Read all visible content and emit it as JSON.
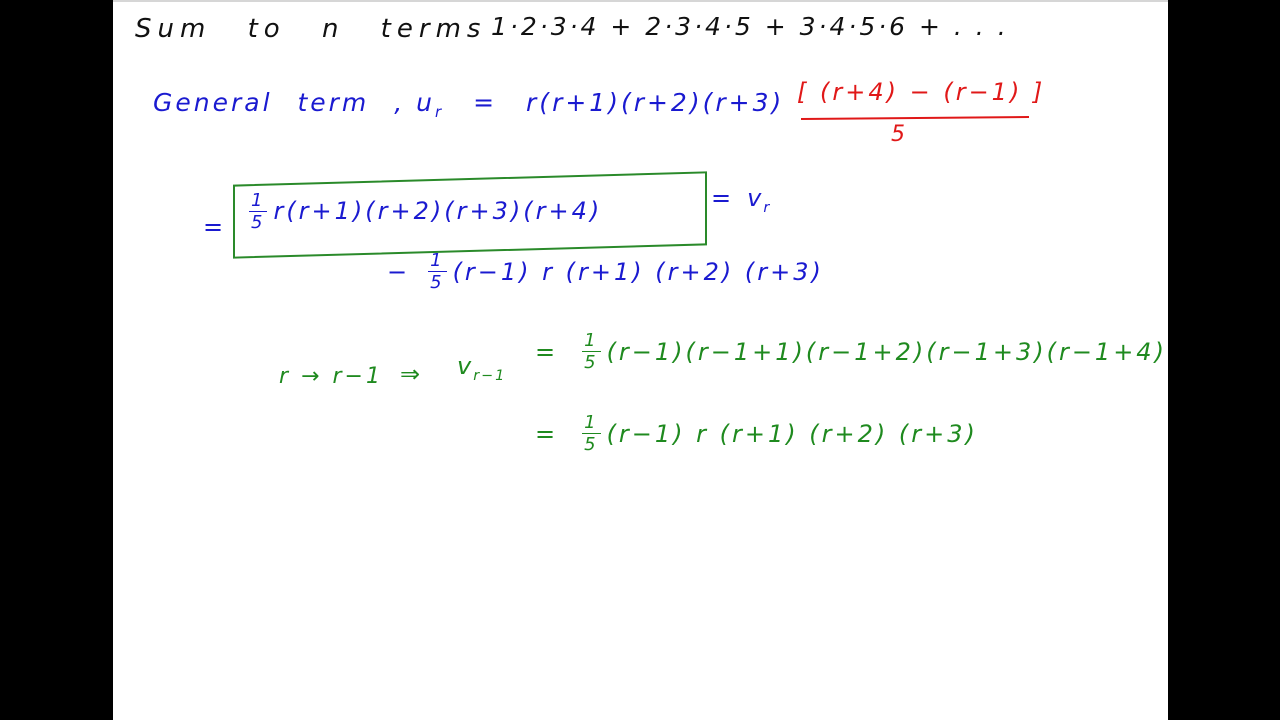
{
  "title_line": {
    "label": "Sum to n terms",
    "series": "1·2·3·4 + 2·3·4·5 + 3·4·5·6 + . . ."
  },
  "general_term": {
    "label": "General term ,",
    "symbol": "u",
    "subscript": "r",
    "equals": "=",
    "expression": "r(r+1)(r+2)(r+3)",
    "red_numerator": "[ (r+4) − (r−1) ]",
    "red_denominator": "5"
  },
  "boxed_line": {
    "equals": "=",
    "frac_num": "1",
    "frac_den": "5",
    "expression": "r(r+1)(r+2)(r+3)(r+4)",
    "rhs_equals": "=",
    "rhs_symbol": "v",
    "rhs_subscript": "r"
  },
  "minus_line": {
    "minus": "−",
    "frac_num": "1",
    "frac_den": "5",
    "expression": "(r−1) r (r+1) (r+2) (r+3)"
  },
  "substitution_line": {
    "mapping": "r → r−1",
    "implies": "⇒",
    "symbol": "v",
    "subscript": "r−1",
    "equals": "=",
    "frac_num": "1",
    "frac_den": "5",
    "expression": "(r−1)(r−1+1)(r−1+2)(r−1+3)(r−1+4)"
  },
  "simplified_line": {
    "equals": "=",
    "frac_num": "1",
    "frac_den": "5",
    "expression": "(r−1) r (r+1) (r+2) (r+3)"
  },
  "colors": {
    "background_bars": "#000000",
    "page": "#ffffff",
    "ink_black": "#111111",
    "ink_blue": "#1a1ad0",
    "ink_red": "#e01818",
    "ink_green": "#1f8a1f"
  }
}
